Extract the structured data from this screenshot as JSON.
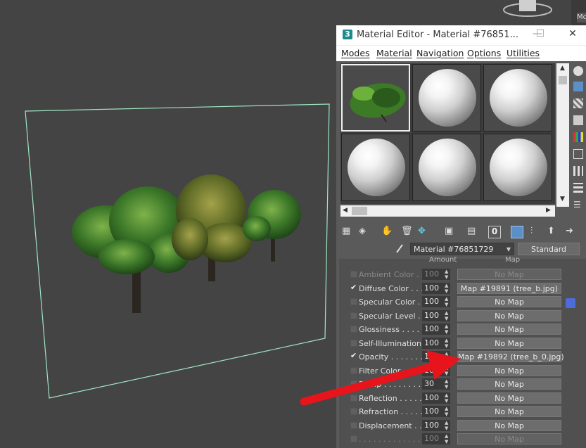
{
  "viewport": {
    "corner_tag": "Mc"
  },
  "material_editor": {
    "title": "Material Editor - Material #76851...",
    "logo": "3",
    "window_controls": {
      "minimize": "—",
      "maximize": "☐",
      "close": "✕"
    },
    "menu": [
      "Modes",
      "Material",
      "Navigation",
      "Options",
      "Utilities"
    ],
    "slots": [
      {
        "type": "tree-thumbnail",
        "active": true
      },
      {
        "type": "sphere"
      },
      {
        "type": "sphere"
      },
      {
        "type": "sphere"
      },
      {
        "type": "sphere"
      },
      {
        "type": "sphere"
      }
    ],
    "material_name": "Material #76851729",
    "material_type": "Standard",
    "columns": {
      "amount": "Amount",
      "map": "Map"
    },
    "maps": [
      {
        "label": "Ambient Color . . .",
        "checked": false,
        "amount": "100",
        "map": "No Map",
        "dim": true
      },
      {
        "label": "Diffuse Color . . . .",
        "checked": true,
        "amount": "100",
        "map": "Map #19891 (tree_b.jpg)"
      },
      {
        "label": "Specular Color . .",
        "checked": false,
        "amount": "100",
        "map": "No Map"
      },
      {
        "label": "Specular Level . .",
        "checked": false,
        "amount": "100",
        "map": "No Map"
      },
      {
        "label": "Glossiness . . . . .",
        "checked": false,
        "amount": "100",
        "map": "No Map"
      },
      {
        "label": "Self-Illumination . .",
        "checked": false,
        "amount": "100",
        "map": "No Map"
      },
      {
        "label": "Opacity . . . . . . .",
        "checked": true,
        "amount": "100",
        "map": "Map #19892 (tree_b_0.jpg)"
      },
      {
        "label": "Filter Color . . . .",
        "checked": false,
        "amount": "100",
        "map": "No Map"
      },
      {
        "label": "Bump . . . . . . . .",
        "checked": false,
        "amount": "30",
        "map": "No Map"
      },
      {
        "label": "Reflection . . . . .",
        "checked": false,
        "amount": "100",
        "map": "No Map"
      },
      {
        "label": "Refraction . . . . .",
        "checked": false,
        "amount": "100",
        "map": "No Map"
      },
      {
        "label": "Displacement . . .",
        "checked": false,
        "amount": "100",
        "map": "No Map"
      },
      {
        "label": ". . . . . . . . . . . . .",
        "checked": false,
        "amount": "100",
        "map": "No Map",
        "dim": true
      }
    ]
  },
  "colors": {
    "annotation_arrow": "#e8141c",
    "plane_outline": "#9fe6c4",
    "selected_tool": "#5d8fc7"
  }
}
